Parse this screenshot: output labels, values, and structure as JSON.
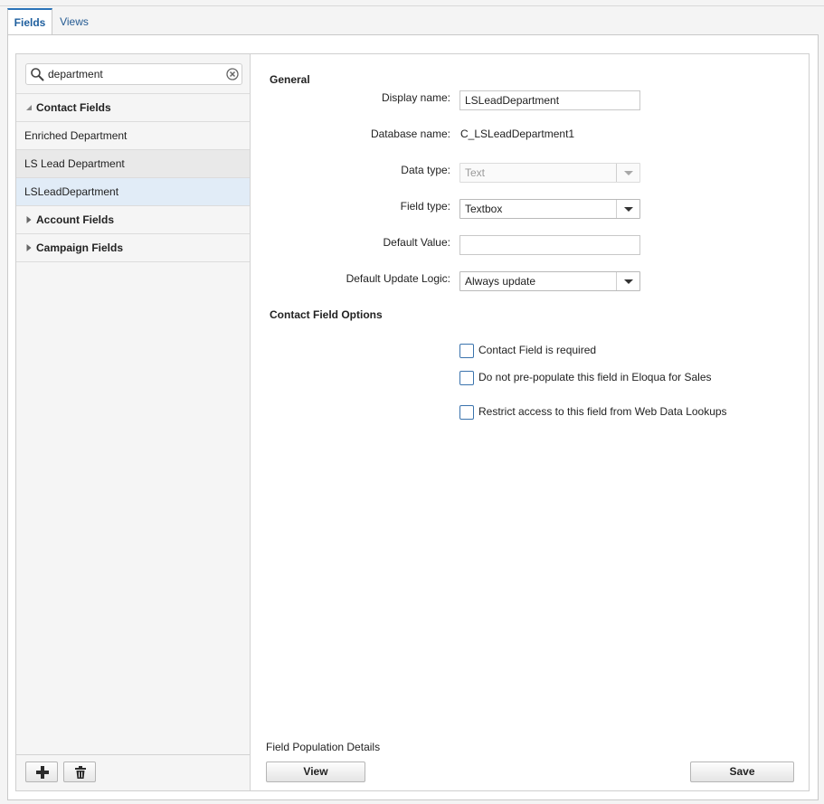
{
  "tabs": [
    {
      "label": "Fields",
      "active": true
    },
    {
      "label": "Views",
      "active": false
    }
  ],
  "search": {
    "value": "department",
    "placeholder": ""
  },
  "tree": {
    "contact_group": "Contact Fields",
    "contact_items": [
      "Enriched Department",
      "LS Lead Department",
      "LSLeadDepartment"
    ],
    "account_group": "Account Fields",
    "campaign_group": "Campaign Fields"
  },
  "general": {
    "title": "General",
    "display_name_label": "Display name:",
    "display_name_value": "LSLeadDepartment",
    "database_name_label": "Database name:",
    "database_name_value": "C_LSLeadDepartment1",
    "data_type_label": "Data type:",
    "data_type_value": "Text",
    "field_type_label": "Field type:",
    "field_type_value": "Textbox",
    "default_value_label": "Default Value:",
    "default_value_value": "",
    "update_logic_label": "Default Update Logic:",
    "update_logic_value": "Always update"
  },
  "options": {
    "title": "Contact Field Options",
    "required_label": "Contact Field is required",
    "no_prepopulate_label": "Do not pre-populate this field in Eloqua for Sales",
    "restrict_label": "Restrict access to this field from Web Data Lookups"
  },
  "footer": {
    "population_label": "Field Population Details",
    "view_button": "View",
    "save_button": "Save"
  },
  "colors": {
    "accent": "#2a73b8",
    "selected_row": "#e1ecf7",
    "checkbox_border": "#3a73ad"
  }
}
